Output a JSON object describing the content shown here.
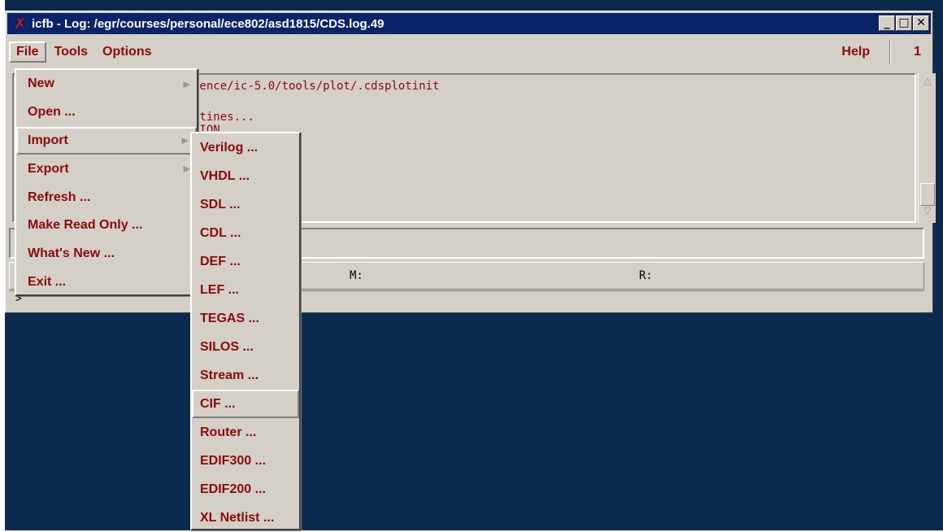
{
  "window": {
    "title": "icfb - Log: /egr/courses/personal/ece802/asd1815/CDS.log.49",
    "icon": "x-logo-icon",
    "controls": {
      "minimize": "_",
      "maximize": "□",
      "close": "✕"
    }
  },
  "menubar": {
    "file": "File",
    "tools": "Tools",
    "options": "Options",
    "help": "Help",
    "number": "1"
  },
  "log": {
    "lines": [
      "lence/ic-5.0/tools/plot/.cdsplotinit",
      "utines...",
      "TION"
    ]
  },
  "status": {
    "mouse_m": "M:",
    "mouse_r": "R:",
    "prompt": ">"
  },
  "file_menu": {
    "items": [
      {
        "label": "New"
      },
      {
        "label": "Open ..."
      },
      {
        "label": "Import"
      },
      {
        "label": "Export"
      },
      {
        "label": "Refresh ..."
      },
      {
        "label": "Make Read Only ..."
      },
      {
        "label": "What's New ..."
      },
      {
        "label": "Exit ..."
      }
    ]
  },
  "import_menu": {
    "items": [
      {
        "label": "Verilog ..."
      },
      {
        "label": "VHDL ..."
      },
      {
        "label": "SDL ..."
      },
      {
        "label": "CDL ..."
      },
      {
        "label": "DEF ..."
      },
      {
        "label": "LEF ..."
      },
      {
        "label": "TEGAS ..."
      },
      {
        "label": "SILOS ..."
      },
      {
        "label": "Stream ..."
      },
      {
        "label": "CIF ..."
      },
      {
        "label": "Router ..."
      },
      {
        "label": "EDIF300 ..."
      },
      {
        "label": "EDIF200 ..."
      },
      {
        "label": "XL Netlist ..."
      }
    ]
  },
  "colors": {
    "desktop": "#0b2a4e",
    "titlebar": "#0a246a",
    "menu_text": "#8b0a0a",
    "panel": "#d4d0c8"
  }
}
